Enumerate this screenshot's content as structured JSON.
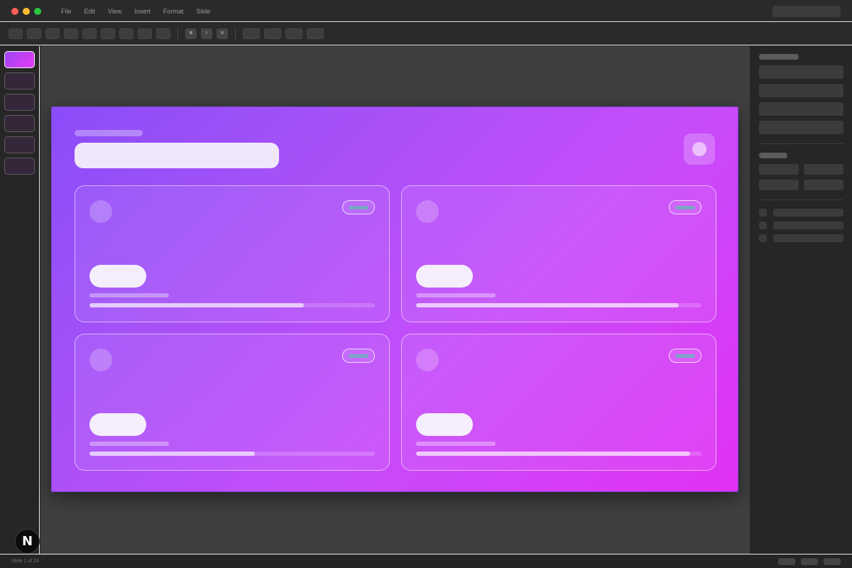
{
  "menu": {
    "items": [
      "File",
      "Edit",
      "View",
      "Insert",
      "Format",
      "Slide"
    ]
  },
  "toolbar": {
    "format_buttons": [
      "B",
      "I",
      "U"
    ]
  },
  "slides_panel": {
    "count_visible": 6,
    "active_index": 0
  },
  "slide": {
    "gradient": [
      "#8b4cf9",
      "#e231f4"
    ],
    "cards": [
      {
        "progress": 0.75
      },
      {
        "progress": 0.92
      },
      {
        "progress": 0.58
      },
      {
        "progress": 0.96
      }
    ]
  },
  "statusbar": {
    "slide_position": "Slide 1 of 24"
  },
  "badge": {
    "letter": "N"
  },
  "colors": {
    "accent": "#a251f8",
    "accent_end": "#e231f4",
    "close": "#ff5f57",
    "minimize": "#febc2e",
    "maximize": "#28c840"
  }
}
